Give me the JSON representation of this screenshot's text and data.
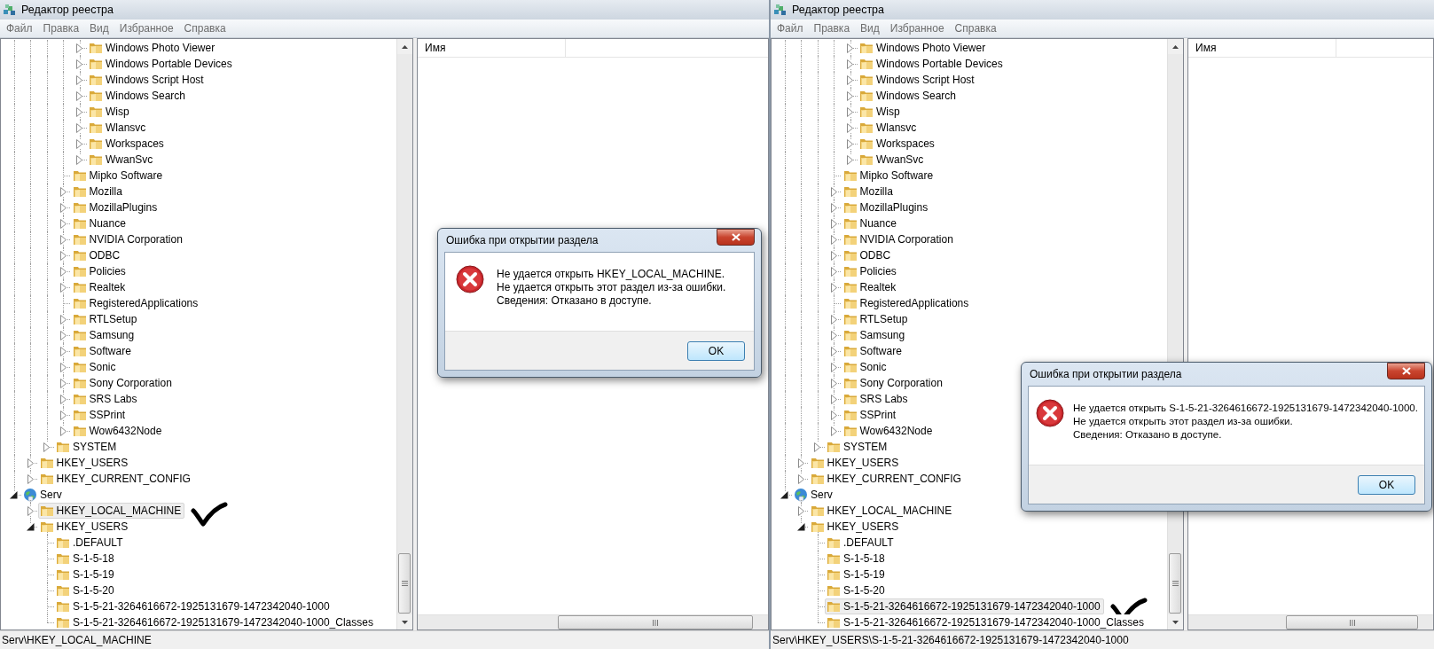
{
  "windows": [
    {
      "title": "Редактор реестра",
      "menu": [
        "Файл",
        "Правка",
        "Вид",
        "Избранное",
        "Справка"
      ],
      "tree": [
        {
          "children": [
            {
              "children": [
                {
                  "children": [
                    {
                      "children": [
                        {
                          "kind": "folder",
                          "label": "Windows Photo Viewer",
                          "expandable": true,
                          "expanded": false,
                          "selected": false
                        },
                        {
                          "kind": "folder",
                          "label": "Windows Portable Devices",
                          "expandable": true,
                          "expanded": false,
                          "selected": false
                        },
                        {
                          "kind": "folder",
                          "label": "Windows Script Host",
                          "expandable": true,
                          "expanded": false,
                          "selected": false
                        },
                        {
                          "kind": "folder",
                          "label": "Windows Search",
                          "expandable": true,
                          "expanded": false,
                          "selected": false
                        },
                        {
                          "kind": "folder",
                          "label": "Wisp",
                          "expandable": true,
                          "expanded": false,
                          "selected": false
                        },
                        {
                          "kind": "folder",
                          "label": "Wlansvc",
                          "expandable": true,
                          "expanded": false,
                          "selected": false
                        },
                        {
                          "kind": "folder",
                          "label": "Workspaces",
                          "expandable": true,
                          "expanded": false,
                          "selected": false
                        },
                        {
                          "kind": "folder",
                          "label": "WwanSvc",
                          "expandable": true,
                          "expanded": false,
                          "selected": false
                        }
                      ]
                    },
                    {
                      "kind": "folder",
                      "label": "Mipko Software",
                      "expandable": false,
                      "selected": false
                    },
                    {
                      "kind": "folder",
                      "label": "Mozilla",
                      "expandable": true,
                      "expanded": false,
                      "selected": false
                    },
                    {
                      "kind": "folder",
                      "label": "MozillaPlugins",
                      "expandable": true,
                      "expanded": false,
                      "selected": false
                    },
                    {
                      "kind": "folder",
                      "label": "Nuance",
                      "expandable": true,
                      "expanded": false,
                      "selected": false
                    },
                    {
                      "kind": "folder",
                      "label": "NVIDIA Corporation",
                      "expandable": true,
                      "expanded": false,
                      "selected": false
                    },
                    {
                      "kind": "folder",
                      "label": "ODBC",
                      "expandable": true,
                      "expanded": false,
                      "selected": false
                    },
                    {
                      "kind": "folder",
                      "label": "Policies",
                      "expandable": true,
                      "expanded": false,
                      "selected": false
                    },
                    {
                      "kind": "folder",
                      "label": "Realtek",
                      "expandable": true,
                      "expanded": false,
                      "selected": false
                    },
                    {
                      "kind": "folder",
                      "label": "RegisteredApplications",
                      "expandable": false,
                      "selected": false
                    },
                    {
                      "kind": "folder",
                      "label": "RTLSetup",
                      "expandable": true,
                      "expanded": false,
                      "selected": false
                    },
                    {
                      "kind": "folder",
                      "label": "Samsung",
                      "expandable": true,
                      "expanded": false,
                      "selected": false
                    },
                    {
                      "kind": "folder",
                      "label": "Software",
                      "expandable": true,
                      "expanded": false,
                      "selected": false
                    },
                    {
                      "kind": "folder",
                      "label": "Sonic",
                      "expandable": true,
                      "expanded": false,
                      "selected": false
                    },
                    {
                      "kind": "folder",
                      "label": "Sony Corporation",
                      "expandable": true,
                      "expanded": false,
                      "selected": false
                    },
                    {
                      "kind": "folder",
                      "label": "SRS Labs",
                      "expandable": true,
                      "expanded": false,
                      "selected": false
                    },
                    {
                      "kind": "folder",
                      "label": "SSPrint",
                      "expandable": true,
                      "expanded": false,
                      "selected": false
                    },
                    {
                      "kind": "folder",
                      "label": "Wow6432Node",
                      "expandable": true,
                      "expanded": false,
                      "selected": false
                    }
                  ]
                },
                {
                  "kind": "folder",
                  "label": "SYSTEM",
                  "expandable": true,
                  "expanded": false,
                  "selected": false
                }
              ]
            },
            {
              "kind": "folder",
              "label": "HKEY_USERS",
              "expandable": true,
              "expanded": false,
              "selected": false
            },
            {
              "kind": "folder",
              "label": "HKEY_CURRENT_CONFIG",
              "expandable": true,
              "expanded": false,
              "selected": false
            }
          ]
        },
        {
          "kind": "computer",
          "label": "Serv",
          "expandable": true,
          "expanded": true,
          "selected": false,
          "children": [
            {
              "kind": "folder",
              "label": "HKEY_LOCAL_MACHINE",
              "expandable": true,
              "expanded": false,
              "selected": true
            },
            {
              "kind": "folder",
              "label": "HKEY_USERS",
              "expandable": true,
              "expanded": true,
              "selected": false,
              "children": [
                {
                  "kind": "folder",
                  "label": ".DEFAULT",
                  "expandable": false,
                  "selected": false
                },
                {
                  "kind": "folder",
                  "label": "S-1-5-18",
                  "expandable": false,
                  "selected": false
                },
                {
                  "kind": "folder",
                  "label": "S-1-5-19",
                  "expandable": false,
                  "selected": false
                },
                {
                  "kind": "folder",
                  "label": "S-1-5-20",
                  "expandable": false,
                  "selected": false
                },
                {
                  "kind": "folder",
                  "label": "S-1-5-21-3264616672-1925131679-1472342040-1000",
                  "expandable": false,
                  "selected": false
                },
                {
                  "kind": "folder",
                  "label": "S-1-5-21-3264616672-1925131679-1472342040-1000_Classes",
                  "expandable": false,
                  "selected": false
                }
              ]
            }
          ]
        }
      ],
      "list": {
        "columns": [
          "Имя"
        ]
      },
      "status": "Serv\\HKEY_LOCAL_MACHINE",
      "dialog": {
        "title": "Ошибка при открытии раздела",
        "message": [
          "Не удается открыть HKEY_LOCAL_MACHINE.",
          "Не удается открыть этот раздел из-за ошибки.",
          "Сведения: Отказано в доступе."
        ],
        "button": "OK"
      }
    },
    {
      "title": "Редактор реестра",
      "menu": [
        "Файл",
        "Правка",
        "Вид",
        "Избранное",
        "Справка"
      ],
      "tree": [
        {
          "children": [
            {
              "children": [
                {
                  "children": [
                    {
                      "children": [
                        {
                          "kind": "folder",
                          "label": "Windows Photo Viewer",
                          "expandable": true,
                          "expanded": false,
                          "selected": false
                        },
                        {
                          "kind": "folder",
                          "label": "Windows Portable Devices",
                          "expandable": true,
                          "expanded": false,
                          "selected": false
                        },
                        {
                          "kind": "folder",
                          "label": "Windows Script Host",
                          "expandable": true,
                          "expanded": false,
                          "selected": false
                        },
                        {
                          "kind": "folder",
                          "label": "Windows Search",
                          "expandable": true,
                          "expanded": false,
                          "selected": false
                        },
                        {
                          "kind": "folder",
                          "label": "Wisp",
                          "expandable": true,
                          "expanded": false,
                          "selected": false
                        },
                        {
                          "kind": "folder",
                          "label": "Wlansvc",
                          "expandable": true,
                          "expanded": false,
                          "selected": false
                        },
                        {
                          "kind": "folder",
                          "label": "Workspaces",
                          "expandable": true,
                          "expanded": false,
                          "selected": false
                        },
                        {
                          "kind": "folder",
                          "label": "WwanSvc",
                          "expandable": true,
                          "expanded": false,
                          "selected": false
                        }
                      ]
                    },
                    {
                      "kind": "folder",
                      "label": "Mipko Software",
                      "expandable": false,
                      "selected": false
                    },
                    {
                      "kind": "folder",
                      "label": "Mozilla",
                      "expandable": true,
                      "expanded": false,
                      "selected": false
                    },
                    {
                      "kind": "folder",
                      "label": "MozillaPlugins",
                      "expandable": true,
                      "expanded": false,
                      "selected": false
                    },
                    {
                      "kind": "folder",
                      "label": "Nuance",
                      "expandable": true,
                      "expanded": false,
                      "selected": false
                    },
                    {
                      "kind": "folder",
                      "label": "NVIDIA Corporation",
                      "expandable": true,
                      "expanded": false,
                      "selected": false
                    },
                    {
                      "kind": "folder",
                      "label": "ODBC",
                      "expandable": true,
                      "expanded": false,
                      "selected": false
                    },
                    {
                      "kind": "folder",
                      "label": "Policies",
                      "expandable": true,
                      "expanded": false,
                      "selected": false
                    },
                    {
                      "kind": "folder",
                      "label": "Realtek",
                      "expandable": true,
                      "expanded": false,
                      "selected": false
                    },
                    {
                      "kind": "folder",
                      "label": "RegisteredApplications",
                      "expandable": false,
                      "selected": false
                    },
                    {
                      "kind": "folder",
                      "label": "RTLSetup",
                      "expandable": true,
                      "expanded": false,
                      "selected": false
                    },
                    {
                      "kind": "folder",
                      "label": "Samsung",
                      "expandable": true,
                      "expanded": false,
                      "selected": false
                    },
                    {
                      "kind": "folder",
                      "label": "Software",
                      "expandable": true,
                      "expanded": false,
                      "selected": false
                    },
                    {
                      "kind": "folder",
                      "label": "Sonic",
                      "expandable": true,
                      "expanded": false,
                      "selected": false
                    },
                    {
                      "kind": "folder",
                      "label": "Sony Corporation",
                      "expandable": true,
                      "expanded": false,
                      "selected": false
                    },
                    {
                      "kind": "folder",
                      "label": "SRS Labs",
                      "expandable": true,
                      "expanded": false,
                      "selected": false
                    },
                    {
                      "kind": "folder",
                      "label": "SSPrint",
                      "expandable": true,
                      "expanded": false,
                      "selected": false
                    },
                    {
                      "kind": "folder",
                      "label": "Wow6432Node",
                      "expandable": true,
                      "expanded": false,
                      "selected": false
                    }
                  ]
                },
                {
                  "kind": "folder",
                  "label": "SYSTEM",
                  "expandable": true,
                  "expanded": false,
                  "selected": false
                }
              ]
            },
            {
              "kind": "folder",
              "label": "HKEY_USERS",
              "expandable": true,
              "expanded": false,
              "selected": false
            },
            {
              "kind": "folder",
              "label": "HKEY_CURRENT_CONFIG",
              "expandable": true,
              "expanded": false,
              "selected": false
            }
          ]
        },
        {
          "kind": "computer",
          "label": "Serv",
          "expandable": true,
          "expanded": true,
          "selected": false,
          "children": [
            {
              "kind": "folder",
              "label": "HKEY_LOCAL_MACHINE",
              "expandable": true,
              "expanded": false,
              "selected": false
            },
            {
              "kind": "folder",
              "label": "HKEY_USERS",
              "expandable": true,
              "expanded": true,
              "selected": false,
              "children": [
                {
                  "kind": "folder",
                  "label": ".DEFAULT",
                  "expandable": false,
                  "selected": false
                },
                {
                  "kind": "folder",
                  "label": "S-1-5-18",
                  "expandable": false,
                  "selected": false
                },
                {
                  "kind": "folder",
                  "label": "S-1-5-19",
                  "expandable": false,
                  "selected": false
                },
                {
                  "kind": "folder",
                  "label": "S-1-5-20",
                  "expandable": false,
                  "selected": false
                },
                {
                  "kind": "folder",
                  "label": "S-1-5-21-3264616672-1925131679-1472342040-1000",
                  "expandable": false,
                  "selected": true
                },
                {
                  "kind": "folder",
                  "label": "S-1-5-21-3264616672-1925131679-1472342040-1000_Classes",
                  "expandable": false,
                  "selected": false
                }
              ]
            }
          ]
        }
      ],
      "list": {
        "columns": [
          "Имя"
        ]
      },
      "status": "Serv\\HKEY_USERS\\S-1-5-21-3264616672-1925131679-1472342040-1000",
      "dialog": {
        "title": "Ошибка при открытии раздела",
        "message": [
          "Не удается открыть S-1-5-21-3264616672-1925131679-1472342040-1000.",
          "Не удается открыть этот раздел из-за ошибки.",
          "Сведения: Отказано в доступе."
        ],
        "button": "OK"
      }
    }
  ]
}
